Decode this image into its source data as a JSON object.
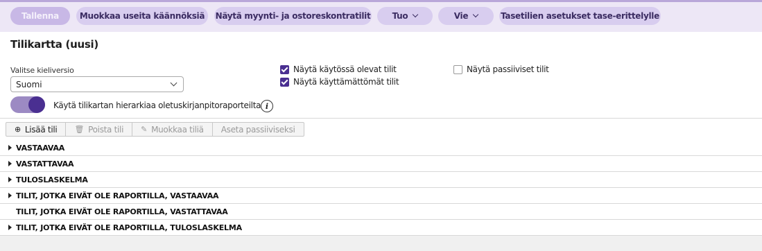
{
  "toolbar": {
    "save_label": "Tallenna",
    "edit_translations_label": "Muokkaa useita käännöksiä",
    "show_contracts_label": "Näytä myynti- ja ostoreskontratilit",
    "import_label": "Tuo",
    "export_label": "Vie",
    "balance_settings_label": "Tasetilien asetukset tase-erittelylle"
  },
  "page": {
    "title": "Tilikartta (uusi)"
  },
  "language": {
    "label": "Valitse kieliversio",
    "selected": "Suomi"
  },
  "hierarchy_toggle": {
    "label": "Käytä tilikartan hierarkiaa oletuskirjanpitoraporteilta",
    "on": true
  },
  "filters": {
    "show_active": {
      "label": "Näytä käytössä olevat tilit",
      "checked": true
    },
    "show_unused": {
      "label": "Näytä käyttämättömät tilit",
      "checked": true
    },
    "show_passive": {
      "label": "Näytä passiiviset tilit",
      "checked": false
    }
  },
  "actions": {
    "add": "Lisää tili",
    "delete": "Poista tili",
    "edit": "Muokkaa tiliä",
    "set_passive": "Aseta passiiviseksi"
  },
  "tree": [
    {
      "label": "VASTAAVAA",
      "expandable": true
    },
    {
      "label": "VASTATTAVAA",
      "expandable": true
    },
    {
      "label": "TULOSLASKELMA",
      "expandable": true
    },
    {
      "label": "TILIT, JOTKA EIVÄT OLE RAPORTILLA, VASTAAVAA",
      "expandable": true
    },
    {
      "label": "TILIT, JOTKA EIVÄT OLE RAPORTILLA, VASTATTAVAA",
      "expandable": false
    },
    {
      "label": "TILIT, JOTKA EIVÄT OLE RAPORTILLA, TULOSLASKELMA",
      "expandable": true
    }
  ],
  "colors": {
    "accent": "#4a2f91",
    "toolbar_bg": "#ede7f6",
    "button_bg": "#d8cdef"
  }
}
